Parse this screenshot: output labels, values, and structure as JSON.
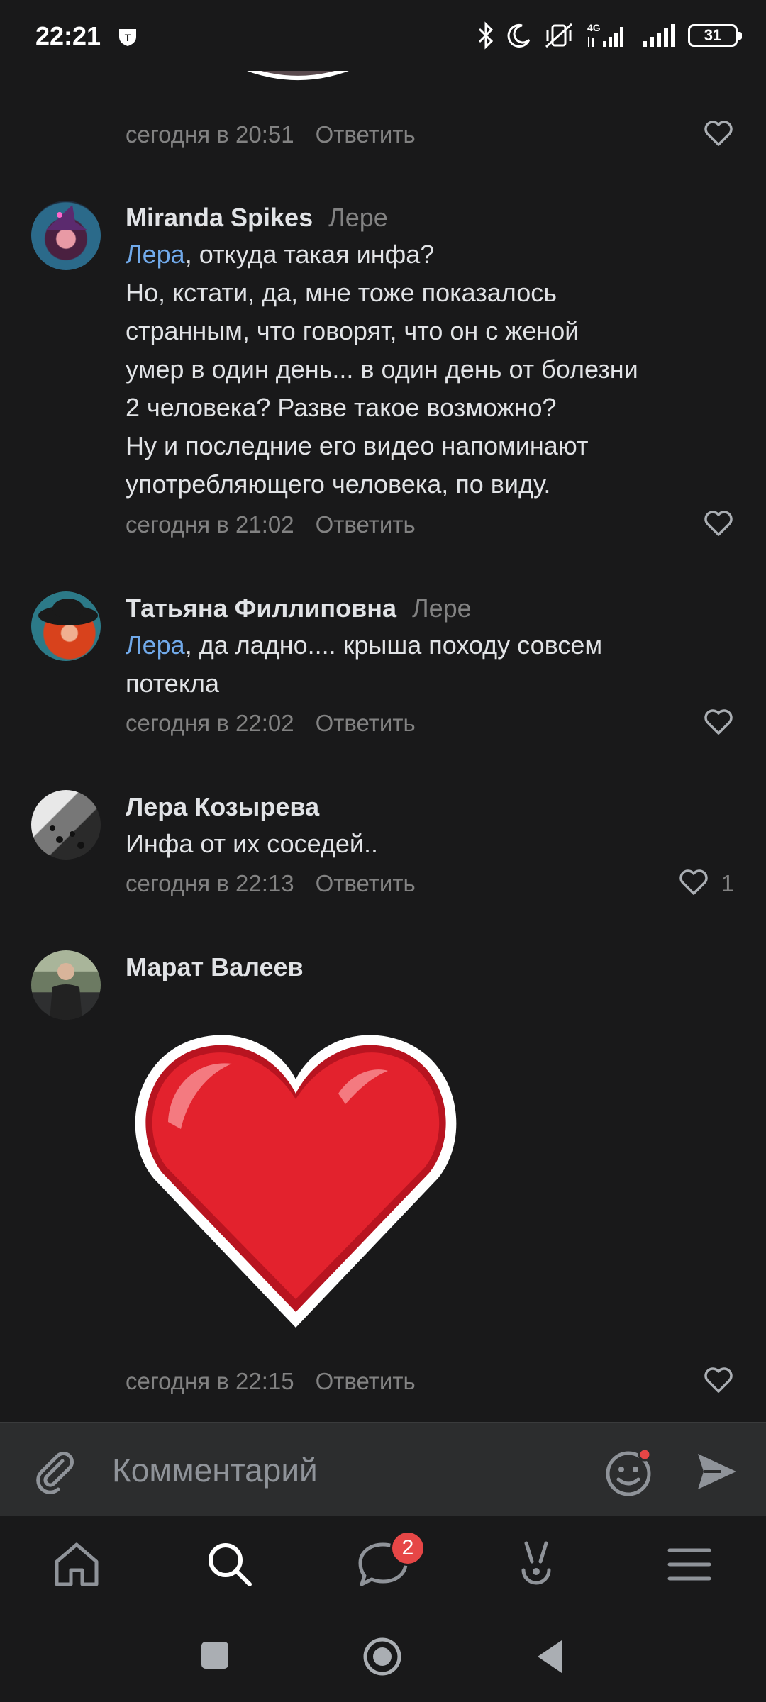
{
  "status_bar": {
    "time": "22:21",
    "battery": "31",
    "network": "4G"
  },
  "comments": [
    {
      "time": "сегодня в 20:51",
      "reply_label": "Ответить"
    },
    {
      "author": "Miranda Spikes",
      "reply_to": "Лере",
      "mention": "Лера",
      "text_first": ", откуда такая инфа?",
      "text_rest": [
        "Но, кстати, да, мне тоже показалось",
        "странным, что говорят, что он с женой",
        "умер в один день... в один день от болезни",
        "2 человека? Разве такое возможно?",
        "Ну и последние его видео напоминают",
        "употребляющего человека, по виду."
      ],
      "time": "сегодня в 21:02",
      "reply_label": "Ответить"
    },
    {
      "author": "Татьяна Филлиповна",
      "reply_to": "Лере",
      "mention": "Лера",
      "text_first": ", да ладно.... крыша походу совсем",
      "text_rest": [
        "потекла"
      ],
      "time": "сегодня в 22:02",
      "reply_label": "Ответить"
    },
    {
      "author": "Лера Козырева",
      "text": "Инфа от их соседей..",
      "time": "сегодня в 22:13",
      "reply_label": "Ответить",
      "likes": "1"
    },
    {
      "author": "Марат Валеев",
      "sticker": "red-heart-sticker",
      "time": "сегодня в 22:15",
      "reply_label": "Ответить"
    }
  ],
  "composer": {
    "placeholder": "Комментарий"
  },
  "nav": {
    "messages_badge": "2"
  },
  "colors": {
    "background": "#19191a",
    "mention": "#71aaeb",
    "secondary": "#828282",
    "badge": "#e64646"
  }
}
